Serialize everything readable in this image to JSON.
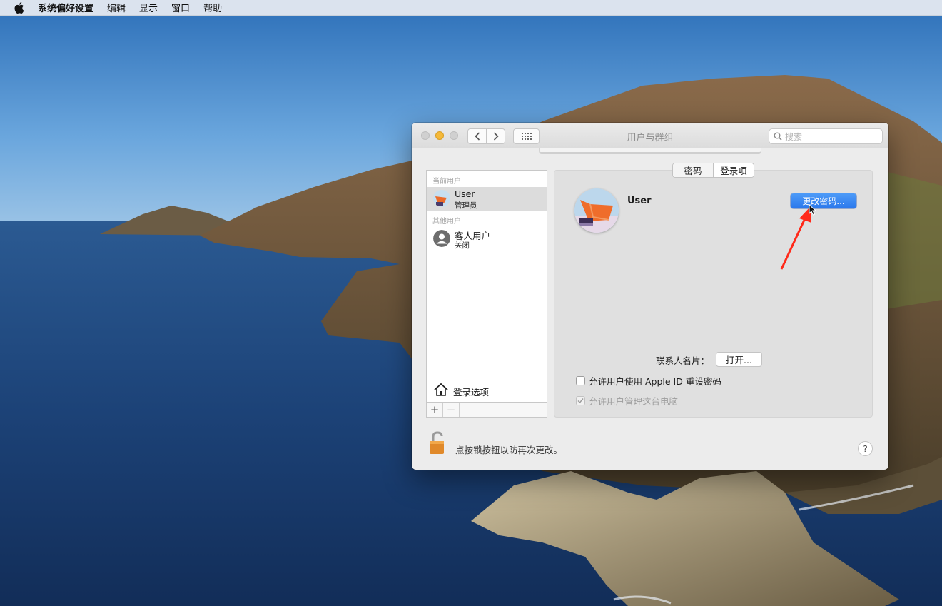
{
  "menubar": {
    "apple_icon": "apple-logo-icon",
    "app_name": "系统偏好设置",
    "items": [
      "编辑",
      "显示",
      "窗口",
      "帮助"
    ]
  },
  "window": {
    "title": "用户与群组",
    "search_placeholder": "搜索",
    "nav": {
      "back_icon": "chevron-left-icon",
      "forward_icon": "chevron-right-icon",
      "grid_icon": "grid-icon"
    }
  },
  "sidebar": {
    "current_users_label": "当前用户",
    "current_user": {
      "name": "User",
      "role": "管理员"
    },
    "other_users_label": "其他用户",
    "guest_user": {
      "name": "客人用户",
      "status": "关闭"
    },
    "login_options_label": "登录选项",
    "add_label": "+",
    "remove_label": "−"
  },
  "main": {
    "tabs": [
      {
        "label": "密码",
        "selected": false
      },
      {
        "label": "登录项",
        "selected": true
      }
    ],
    "user_name": "User",
    "change_password_label": "更改密码...",
    "contact_card_label": "联系人名片：",
    "open_button_label": "打开...",
    "allow_apple_id_reset": {
      "label": "允许用户使用 Apple ID 重设密码",
      "checked": false
    },
    "allow_admin": {
      "label": "允许用户管理这台电脑",
      "checked": true,
      "disabled": true
    }
  },
  "footer": {
    "lock_text": "点按锁按钮以防再次更改。",
    "help_label": "?"
  },
  "colors": {
    "accent_button": "#2b78ec",
    "annotation_arrow": "#ff2a1a",
    "minimize_light": "#f5b93a"
  }
}
